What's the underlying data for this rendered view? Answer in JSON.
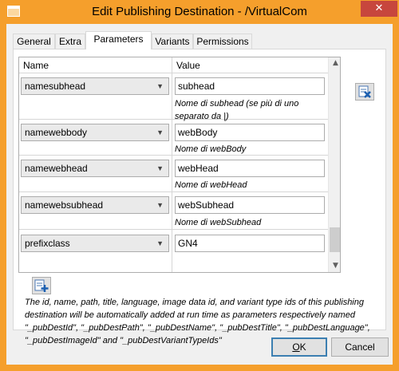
{
  "window": {
    "title": "Edit Publishing Destination - /VirtualCom",
    "close_glyph": "✕",
    "icon": "window-app-icon"
  },
  "tabs": [
    {
      "label": "General",
      "active": false
    },
    {
      "label": "Extra",
      "active": false
    },
    {
      "label": "Parameters",
      "active": true
    },
    {
      "label": "Variants",
      "active": false
    },
    {
      "label": "Permissions",
      "active": false
    }
  ],
  "grid": {
    "col_name": "Name",
    "col_value": "Value",
    "rows": [
      {
        "name": "namesubhead",
        "value": "subhead",
        "description": "Nome di subhead (se più di uno separato da |)"
      },
      {
        "name": "namewebbody",
        "value": "webBody",
        "description": "Nome di webBody"
      },
      {
        "name": "namewebhead",
        "value": "webHead",
        "description": "Nome di webHead"
      },
      {
        "name": "namewebsubhead",
        "value": "webSubhead",
        "description": "Nome di webSubhead"
      },
      {
        "name": "prefixclass",
        "value": "GN4",
        "description": ""
      }
    ],
    "scroll_up": "▲",
    "scroll_down": "▼"
  },
  "info_text": "The id, name, path, title, language, image data id, and variant type ids of this publishing destination will be automatically added at run time as parameters respectively named \"_pubDestId\", \"_pubDestPath\", \"_pubDestName\", \"_pubDestTitle\", \"_pubDestLanguage\", \"_pubDestImageId\" and \"_pubDestVariantTypeIds\"",
  "buttons": {
    "ok": "OK",
    "ok_rest": "K",
    "ok_mnemonic": "O",
    "cancel": "Cancel"
  },
  "icons": {
    "remove": "remove-parameter-icon",
    "add": "add-parameter-icon"
  },
  "colors": {
    "title_bar": "#f59f2c",
    "close_button": "#c7463d",
    "ok_border": "#3c7fb1"
  }
}
